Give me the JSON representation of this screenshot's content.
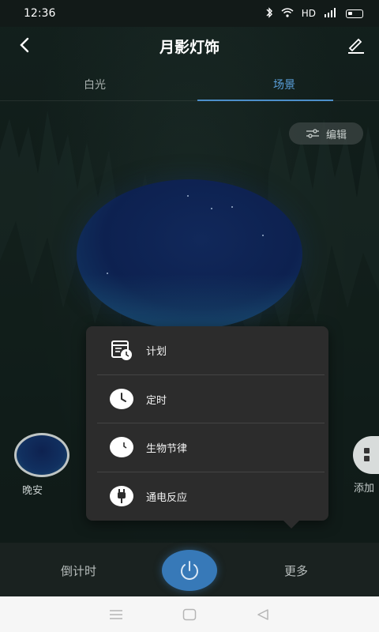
{
  "status_bar": {
    "time": "12:36",
    "network_label": "HD"
  },
  "header": {
    "title": "月影灯饰"
  },
  "tabs": [
    {
      "label": "白光",
      "active": false
    },
    {
      "label": "场景",
      "active": true
    }
  ],
  "edit_chip": {
    "label": "编辑"
  },
  "scenes": [
    {
      "label": "晚安"
    },
    {
      "label": "添加"
    }
  ],
  "popup_menu": {
    "items": [
      {
        "label": "计划",
        "icon": "calendar-clock-icon"
      },
      {
        "label": "定时",
        "icon": "clock-icon"
      },
      {
        "label": "生物节律",
        "icon": "moon-clock-icon"
      },
      {
        "label": "通电反应",
        "icon": "plug-icon"
      }
    ]
  },
  "bottom_bar": {
    "left_label": "倒计时",
    "right_label": "更多"
  },
  "colors": {
    "accent": "#4d8fca",
    "power_button": "#3779b8",
    "menu_bg": "#2c2c2c"
  }
}
